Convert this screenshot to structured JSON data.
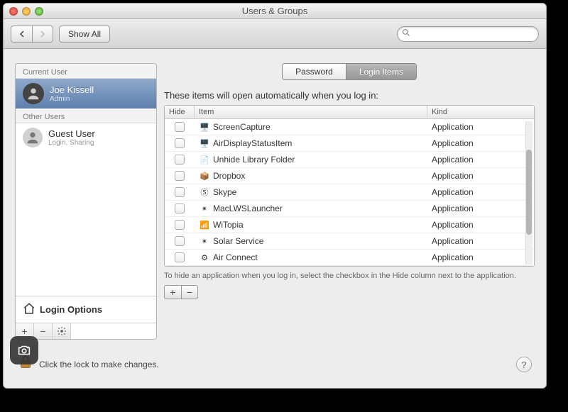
{
  "window": {
    "title": "Users & Groups"
  },
  "toolbar": {
    "show_all": "Show All",
    "search_placeholder": ""
  },
  "sidebar": {
    "current_header": "Current User",
    "other_header": "Other Users",
    "current": {
      "name": "Joe Kissell",
      "role": "Admin"
    },
    "other": {
      "name": "Guest User",
      "role": "Login, Sharing"
    },
    "login_options": "Login Options"
  },
  "tabs": {
    "password": "Password",
    "login_items": "Login Items"
  },
  "main": {
    "heading": "These items will open automatically when you log in:",
    "columns": {
      "hide": "Hide",
      "item": "Item",
      "kind": "Kind"
    },
    "rows": [
      {
        "name": "ScreenCapture",
        "kind": "Application",
        "icon": "🖥️"
      },
      {
        "name": "AirDisplayStatusItem",
        "kind": "Application",
        "icon": "🖥️"
      },
      {
        "name": "Unhide Library Folder",
        "kind": "Application",
        "icon": "📄"
      },
      {
        "name": "Dropbox",
        "kind": "Application",
        "icon": "📦"
      },
      {
        "name": "Skype",
        "kind": "Application",
        "icon": "Ⓢ"
      },
      {
        "name": "MacLWSLauncher",
        "kind": "Application",
        "icon": "✴︎"
      },
      {
        "name": "WiTopia",
        "kind": "Application",
        "icon": "📶"
      },
      {
        "name": "Solar Service",
        "kind": "Application",
        "icon": "✴︎"
      },
      {
        "name": "Air Connect",
        "kind": "Application",
        "icon": "⚙"
      }
    ],
    "hint": "To hide an application when you log in, select the checkbox in the Hide column next to the application."
  },
  "footer": {
    "lock_text": "Click the lock to make changes."
  }
}
